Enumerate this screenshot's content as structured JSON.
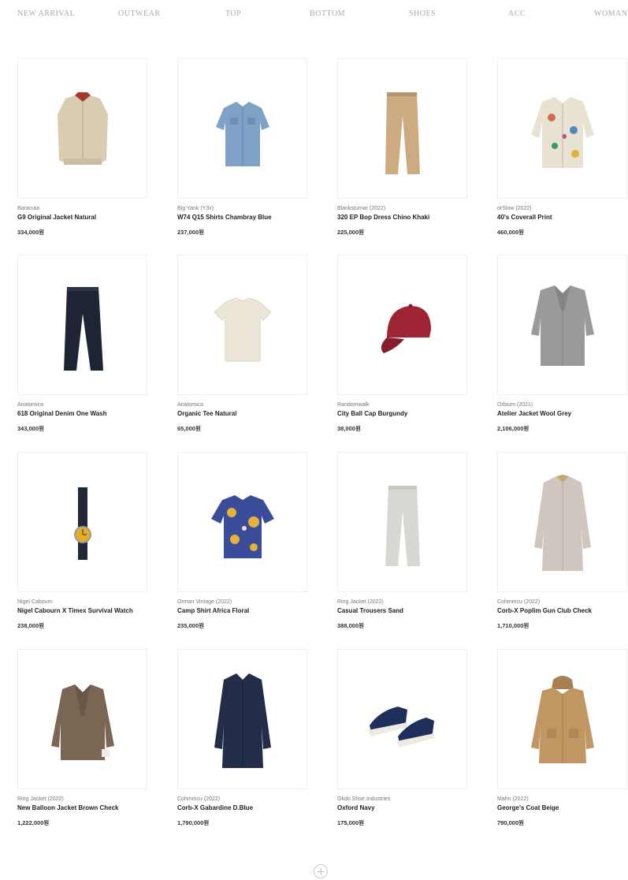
{
  "nav": {
    "items": [
      "NEW ARRIVAL",
      "OUTWEAR",
      "TOP",
      "BOTTOM",
      "SHOES",
      "ACC",
      "WOMAN"
    ]
  },
  "products": [
    {
      "brand": "Baracuta",
      "name": "G9 Original Jacket Natural",
      "price": "334,000원",
      "icon": "harrington-jacket-icon",
      "color": "#d9ccb3"
    },
    {
      "brand": "Big Yank (Y3x)",
      "name": "W74 Q15 Shirts Chambray Blue",
      "price": "237,000원",
      "icon": "chambray-shirt-icon",
      "color": "#7fa1c6"
    },
    {
      "brand": "Blankstumar (2022)",
      "name": "320 EP Bop Dress Chino Khaki",
      "price": "225,000원",
      "icon": "chino-pants-icon",
      "color": "#ccaa82"
    },
    {
      "brand": "orSlow (2022)",
      "name": "40's Coverall Print",
      "price": "460,000원",
      "icon": "printed-coverall-icon",
      "color": "#e8e2d3"
    },
    {
      "brand": "Anatomica",
      "name": "618 Original Denim One Wash",
      "price": "343,000원",
      "icon": "denim-jeans-icon",
      "color": "#1e2433"
    },
    {
      "brand": "Anatomica",
      "name": "Organic Tee Natural",
      "price": "65,000원",
      "icon": "tshirt-icon",
      "color": "#ece6d8"
    },
    {
      "brand": "Randomwalk",
      "name": "City Ball Cap Burgundy",
      "price": "38,000원",
      "icon": "ball-cap-icon",
      "color": "#9e2433"
    },
    {
      "brand": "Orbium (2021)",
      "name": "Atelier Jacket Wool Grey",
      "price": "2,106,000원",
      "icon": "wool-jacket-icon",
      "color": "#9a9a9a"
    },
    {
      "brand": "Nigel Cabourn",
      "name": "Nigel Cabourn X Timex Survival Watch",
      "price": "238,000원",
      "icon": "wrist-watch-icon",
      "color": "#e0ae2a"
    },
    {
      "brand": "Orman Vintage (2022)",
      "name": "Camp Shirt Africa Floral",
      "price": "235,000원",
      "icon": "floral-shirt-icon",
      "color": "#3b4c9a"
    },
    {
      "brand": "Ring Jacket (2022)",
      "name": "Casual Trousers Sand",
      "price": "388,000원",
      "icon": "trousers-icon",
      "color": "#d5d9d2"
    },
    {
      "brand": "Cohmmcu (2022)",
      "name": "Corb-X Poplim Gun Club Check",
      "price": "1,710,000원",
      "icon": "long-coat-icon",
      "color": "#cfc6c0"
    },
    {
      "brand": "Ring Jacket (2022)",
      "name": "New Balloon Jacket Brown Check",
      "price": "1,222,000원",
      "icon": "tweed-blazer-icon",
      "color": "#7a6653"
    },
    {
      "brand": "Cohmmcu (2022)",
      "name": "Corb-X Gabardine D.Blue",
      "price": "1,790,000원",
      "icon": "navy-coat-icon",
      "color": "#232c48"
    },
    {
      "brand": "Gkdo Shoe Industries",
      "name": "Oxford Navy",
      "price": "175,000원",
      "icon": "sneakers-icon",
      "color": "#1f2f5c"
    },
    {
      "brand": "Mahn (2022)",
      "name": "George's Coat Beige",
      "price": "790,000원",
      "icon": "hooded-coat-icon",
      "color": "#c09663"
    }
  ],
  "load_more_label": "Load more"
}
